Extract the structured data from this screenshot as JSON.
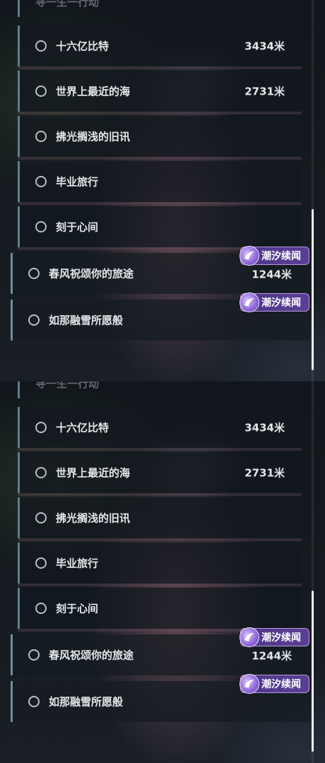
{
  "panels": [
    {
      "peek_label": "寻一生一行动",
      "items": [
        {
          "label": "十六亿比特",
          "distance": "3434米"
        },
        {
          "label": "世界上最近的海",
          "distance": "2731米"
        },
        {
          "label": "拂光搁浅的旧讯",
          "distance": ""
        },
        {
          "label": "毕业旅行",
          "distance": ""
        },
        {
          "label": "刻于心间",
          "distance": ""
        }
      ],
      "quests": [
        {
          "label": "春风祝颂你的旅途",
          "distance": "1244米",
          "badge": "潮汐续闻"
        },
        {
          "label": "如那融雪所愿般",
          "distance": "",
          "badge": "潮汐续闻"
        }
      ]
    },
    {
      "peek_label": "寻一生一行动",
      "items": [
        {
          "label": "十六亿比特",
          "distance": "3434米"
        },
        {
          "label": "世界上最近的海",
          "distance": "2731米"
        },
        {
          "label": "拂光搁浅的旧讯",
          "distance": ""
        },
        {
          "label": "毕业旅行",
          "distance": ""
        },
        {
          "label": "刻于心间",
          "distance": ""
        }
      ],
      "quests": [
        {
          "label": "春风祝颂你的旅途",
          "distance": "1244米",
          "badge": "潮汐续闻"
        },
        {
          "label": "如那融雪所愿般",
          "distance": "",
          "badge": "潮汐续闻"
        }
      ]
    }
  ],
  "colors": {
    "badge_bg": "#4c3687",
    "row_accent": "#5d7f8c",
    "text": "#e4e7ea"
  },
  "icons": {
    "radio": "radio-circle-icon",
    "badge": "tidal-swirl-icon"
  }
}
